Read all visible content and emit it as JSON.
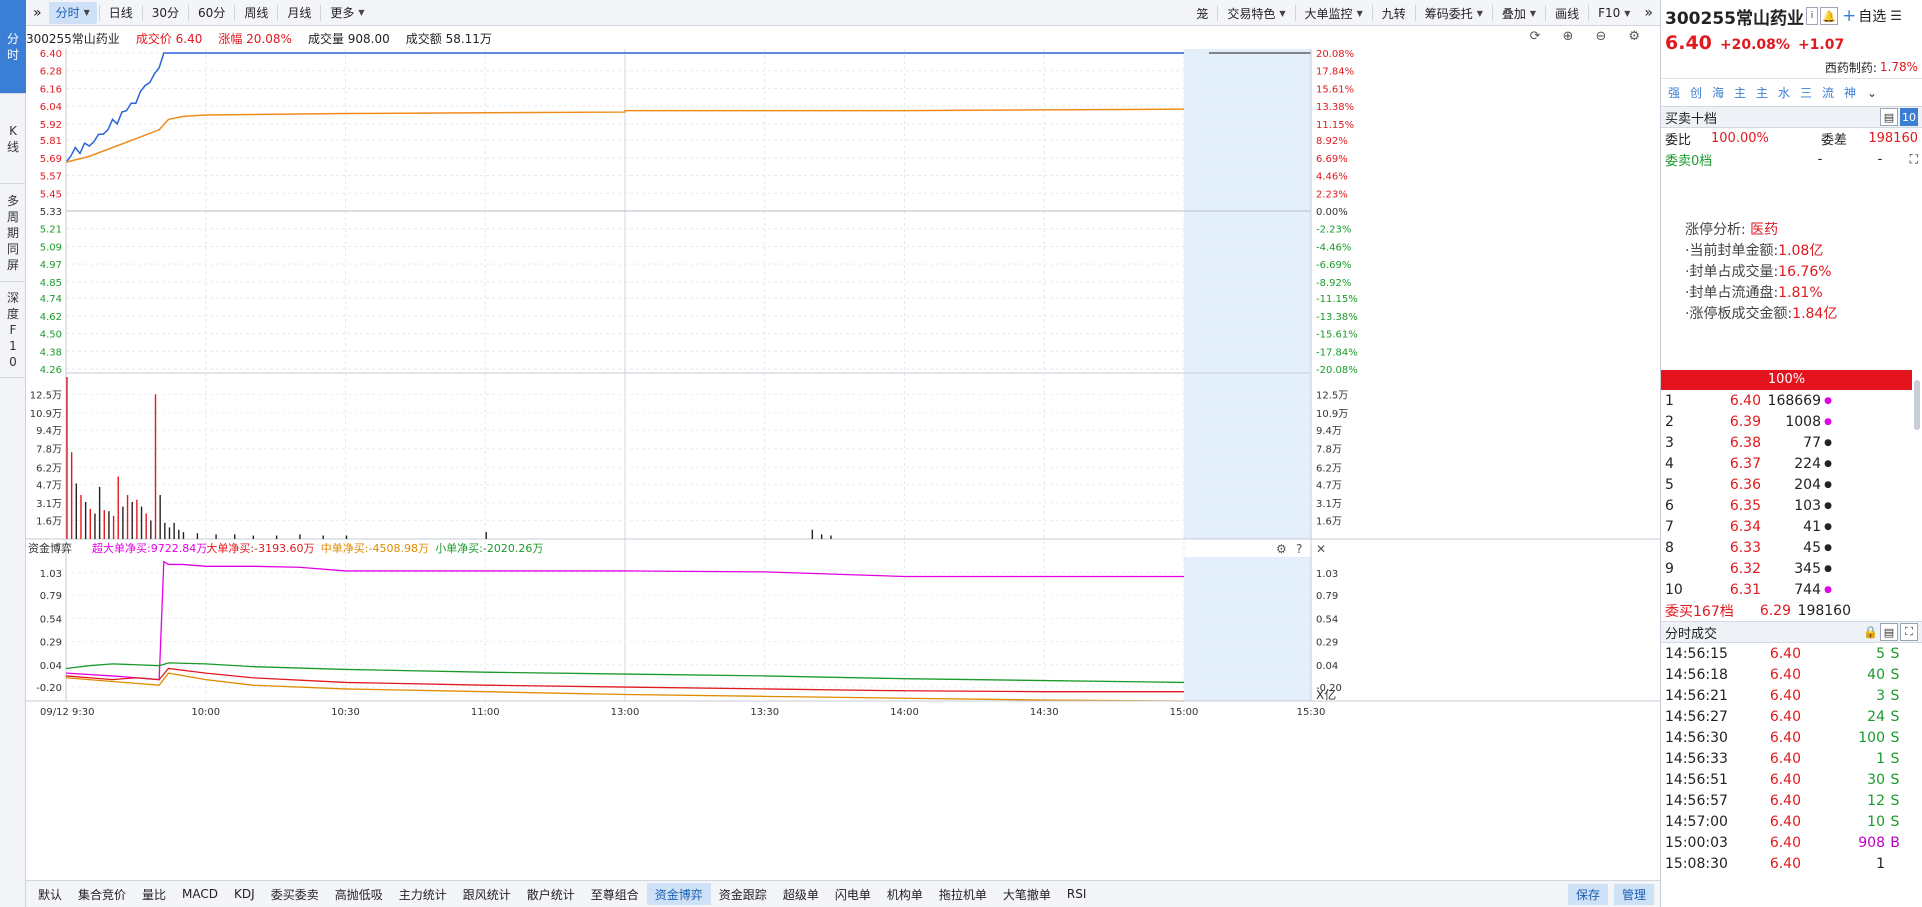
{
  "left_tabs": [
    {
      "label": "分\n时",
      "active": true
    },
    {
      "label": "K\n线",
      "active": false
    },
    {
      "label": "多\n周\n期\n同\n屏",
      "active": false
    },
    {
      "label": "深\n度\nF\n1\n0",
      "active": false
    }
  ],
  "toolbar": {
    "left": [
      {
        "label": "分时",
        "active": true,
        "dropdown": true
      },
      {
        "label": "日线"
      },
      {
        "label": "30分"
      },
      {
        "label": "60分"
      },
      {
        "label": "周线"
      },
      {
        "label": "月线"
      },
      {
        "label": "更多",
        "dropdown": true
      }
    ],
    "right": [
      {
        "label": "笼"
      },
      {
        "label": "交易特色",
        "dropdown": true
      },
      {
        "label": "大单监控",
        "dropdown": true
      },
      {
        "label": "九转"
      },
      {
        "label": "筹码委托",
        "dropdown": true
      },
      {
        "label": "叠加",
        "dropdown": true
      },
      {
        "label": "画线"
      },
      {
        "label": "F10",
        "dropdown": true
      }
    ]
  },
  "infobar": {
    "code_name": "300255常山药业",
    "price_label": "成交价 6.40",
    "change_label": "涨幅 20.08%",
    "volume_label": "成交量 908.00",
    "amount_label": "成交额 58.11万"
  },
  "chart_data": [
    {
      "type": "line",
      "title": "",
      "y_left_ticks": [
        "6.40",
        "6.28",
        "6.16",
        "6.04",
        "5.92",
        "5.81",
        "5.69",
        "5.57",
        "5.45",
        "5.33",
        "5.21",
        "5.09",
        "4.97",
        "4.85",
        "4.74",
        "4.62",
        "4.50",
        "4.38",
        "4.26"
      ],
      "y_right_ticks": [
        "20.08%",
        "17.84%",
        "15.61%",
        "13.38%",
        "11.15%",
        "8.92%",
        "6.69%",
        "4.46%",
        "2.23%",
        "0.00%",
        "-2.23%",
        "-4.46%",
        "-6.69%",
        "-8.92%",
        "-11.15%",
        "-13.38%",
        "-15.61%",
        "-17.84%",
        "-20.08%"
      ],
      "ylim": [
        4.26,
        6.4
      ],
      "prev_close": 5.33,
      "series": [
        {
          "color": "#2b64d8",
          "values_time": [
            "9:30",
            "9:31",
            "9:32",
            "9:33",
            "9:34",
            "9:35",
            "9:36",
            "9:37",
            "9:38",
            "9:39",
            "9:40",
            "9:41",
            "9:42",
            "9:43",
            "9:44",
            "9:45",
            "9:46",
            "9:47",
            "9:48",
            "9:49",
            "9:50",
            "9:51",
            "9:52",
            "15:00"
          ],
          "values": [
            5.66,
            5.7,
            5.76,
            5.72,
            5.79,
            5.77,
            5.8,
            5.85,
            5.85,
            5.88,
            5.95,
            5.92,
            6.0,
            6.01,
            6.06,
            6.06,
            6.14,
            6.18,
            6.2,
            6.26,
            6.3,
            6.4,
            6.4,
            6.4
          ]
        },
        {
          "color": "#f08c1e",
          "values_time": [
            "9:30",
            "9:35",
            "9:40",
            "9:45",
            "9:50",
            "9:52",
            "9:55",
            "10:00",
            "10:30",
            "11:00",
            "11:30",
            "13:00",
            "14:00",
            "15:00"
          ],
          "values": [
            5.66,
            5.7,
            5.76,
            5.82,
            5.88,
            5.95,
            5.97,
            5.98,
            5.99,
            5.995,
            6.0,
            6.01,
            6.01,
            6.02
          ]
        }
      ]
    },
    {
      "type": "bar",
      "title": "",
      "y_ticks": [
        "12.5万",
        "10.9万",
        "9.4万",
        "7.8万",
        "6.2万",
        "4.7万",
        "3.1万",
        "1.6万"
      ],
      "ylim": [
        0,
        140000
      ],
      "bars": [
        {
          "t": 0,
          "v": 140000,
          "c": "r"
        },
        {
          "t": 1,
          "v": 75000,
          "c": "r"
        },
        {
          "t": 2,
          "v": 48000,
          "c": "k"
        },
        {
          "t": 3,
          "v": 38000,
          "c": "r"
        },
        {
          "t": 4,
          "v": 32000,
          "c": "k"
        },
        {
          "t": 5,
          "v": 26000,
          "c": "r"
        },
        {
          "t": 6,
          "v": 22000,
          "c": "k"
        },
        {
          "t": 7,
          "v": 45000,
          "c": "k"
        },
        {
          "t": 8,
          "v": 25000,
          "c": "r"
        },
        {
          "t": 9,
          "v": 24000,
          "c": "k"
        },
        {
          "t": 10,
          "v": 20000,
          "c": "r"
        },
        {
          "t": 11,
          "v": 54000,
          "c": "r"
        },
        {
          "t": 12,
          "v": 28000,
          "c": "k"
        },
        {
          "t": 13,
          "v": 38000,
          "c": "r"
        },
        {
          "t": 14,
          "v": 32000,
          "c": "k"
        },
        {
          "t": 15,
          "v": 34000,
          "c": "r"
        },
        {
          "t": 16,
          "v": 28000,
          "c": "k"
        },
        {
          "t": 17,
          "v": 22000,
          "c": "r"
        },
        {
          "t": 18,
          "v": 16000,
          "c": "k"
        },
        {
          "t": 19,
          "v": 125000,
          "c": "r"
        },
        {
          "t": 20,
          "v": 38000,
          "c": "k"
        },
        {
          "t": 21,
          "v": 14000,
          "c": "k"
        },
        {
          "t": 22,
          "v": 10000,
          "c": "k"
        },
        {
          "t": 23,
          "v": 14000,
          "c": "k"
        },
        {
          "t": 24,
          "v": 8000,
          "c": "k"
        },
        {
          "t": 25,
          "v": 6000,
          "c": "k"
        },
        {
          "t": 28,
          "v": 5000,
          "c": "k"
        },
        {
          "t": 32,
          "v": 4000,
          "c": "k"
        },
        {
          "t": 36,
          "v": 4000,
          "c": "k"
        },
        {
          "t": 40,
          "v": 3000,
          "c": "k"
        },
        {
          "t": 45,
          "v": 3000,
          "c": "k"
        },
        {
          "t": 50,
          "v": 4000,
          "c": "k"
        },
        {
          "t": 55,
          "v": 3000,
          "c": "k"
        },
        {
          "t": 60,
          "v": 3000,
          "c": "k"
        },
        {
          "t": 90,
          "v": 6000,
          "c": "k"
        },
        {
          "t": 160,
          "v": 8000,
          "c": "k"
        },
        {
          "t": 162,
          "v": 4000,
          "c": "k"
        },
        {
          "t": 164,
          "v": 3000,
          "c": "k"
        }
      ]
    },
    {
      "type": "line",
      "title": "资金博弈",
      "legend": [
        {
          "label": "超大单净买:9722.84万",
          "color": "#e400e4"
        },
        {
          "label": "大单净买:-3193.60万",
          "color": "#e1191e"
        },
        {
          "label": "中单净买:-4508.98万",
          "color": "#e08a00"
        },
        {
          "label": "小单净买:-2020.26万",
          "color": "#1a9a2b"
        }
      ],
      "y_ticks": [
        "1.03",
        "0.79",
        "0.54",
        "0.29",
        "0.04",
        "-0.20"
      ],
      "y_unit": "X亿",
      "ylim": [
        -0.35,
        1.2
      ],
      "series": [
        {
          "color": "#e400e4",
          "t": [
            0,
            10,
            20,
            21,
            22,
            25,
            30,
            40,
            50,
            60,
            90,
            120,
            150,
            180,
            210,
            240
          ],
          "v": [
            -0.05,
            -0.08,
            -0.12,
            1.15,
            1.12,
            1.12,
            1.1,
            1.1,
            1.09,
            1.05,
            1.05,
            1.05,
            1.04,
            0.99,
            0.99,
            0.99
          ]
        },
        {
          "color": "#1a9a2b",
          "t": [
            0,
            5,
            10,
            15,
            20,
            22,
            30,
            40,
            60,
            90,
            120,
            150,
            180,
            210,
            240
          ],
          "v": [
            0.0,
            0.03,
            0.05,
            0.04,
            0.03,
            0.06,
            0.05,
            0.02,
            -0.01,
            -0.04,
            -0.06,
            -0.08,
            -0.11,
            -0.13,
            -0.15
          ]
        },
        {
          "color": "#e1191e",
          "t": [
            0,
            5,
            10,
            15,
            20,
            22,
            30,
            40,
            60,
            90,
            120,
            150,
            180,
            210,
            240
          ],
          "v": [
            -0.08,
            -0.1,
            -0.12,
            -0.1,
            -0.12,
            0.0,
            -0.05,
            -0.1,
            -0.15,
            -0.18,
            -0.2,
            -0.22,
            -0.24,
            -0.25,
            -0.25
          ]
        },
        {
          "color": "#e08a00",
          "t": [
            0,
            5,
            10,
            15,
            20,
            22,
            30,
            40,
            60,
            90,
            120,
            150,
            180,
            210,
            240
          ],
          "v": [
            -0.1,
            -0.12,
            -0.14,
            -0.16,
            -0.18,
            -0.05,
            -0.12,
            -0.18,
            -0.22,
            -0.25,
            -0.28,
            -0.3,
            -0.32,
            -0.34,
            -0.35
          ]
        }
      ]
    }
  ],
  "x_axis": {
    "date": "09/12 9:30",
    "ticks": [
      "10:00",
      "10:30",
      "11:00",
      "13:00",
      "13:30",
      "14:00",
      "14:30",
      "15:00",
      "15:30"
    ]
  },
  "bottom_tabs": [
    {
      "label": "默认"
    },
    {
      "label": "集合竞价"
    },
    {
      "label": "量比"
    },
    {
      "label": "MACD"
    },
    {
      "label": "KDJ"
    },
    {
      "label": "委买委卖"
    },
    {
      "label": "高抛低吸"
    },
    {
      "label": "主力统计"
    },
    {
      "label": "跟风统计"
    },
    {
      "label": "散户统计"
    },
    {
      "label": "至尊组合"
    },
    {
      "label": "资金博弈",
      "active": true
    },
    {
      "label": "资金跟踪"
    },
    {
      "label": "超级单"
    },
    {
      "label": "闪电单"
    },
    {
      "label": "机构单"
    },
    {
      "label": "拖拉机单"
    },
    {
      "label": "大笔撤单"
    },
    {
      "label": "RSI"
    }
  ],
  "bottom_buttons": {
    "save": "保存",
    "manage": "管理"
  },
  "right_panel": {
    "title": "300255常山药业",
    "watch_btn": "自选",
    "price": "6.40",
    "change_pct": "+20.08%",
    "change_amt": "+1.07",
    "sector": "西药制药:",
    "sector_pct": "1.78%",
    "quick_buttons": [
      "强",
      "创",
      "海",
      "主",
      "主",
      "水",
      "三",
      "流",
      "神"
    ],
    "orderbook_title": "买卖十档",
    "orderbook_toggle": "10",
    "weibi_label": "委比",
    "weibi_value": "100.00%",
    "weicha_label": "委差",
    "weicha_value": "198160",
    "weimai0_label": "委卖0档",
    "weimai0_a": "-",
    "weimai0_b": "-",
    "limit_analysis": {
      "label": "涨停分析:",
      "value": "医药",
      "rows": [
        {
          "label": "·当前封单金额:",
          "value": "1.08亿"
        },
        {
          "label": "·封单占成交量:",
          "value": "16.76%"
        },
        {
          "label": "·封单占流通盘:",
          "value": "1.81%"
        },
        {
          "label": "·涨停板成交金额:",
          "value": "1.84亿"
        }
      ]
    },
    "bar_pct": "100%",
    "bids": [
      {
        "lvl": "1",
        "px": "6.40",
        "vol": "168669",
        "dot": "#e400e4"
      },
      {
        "lvl": "2",
        "px": "6.39",
        "vol": "1008",
        "dot": "#e400e4"
      },
      {
        "lvl": "3",
        "px": "6.38",
        "vol": "77",
        "dot": "#222"
      },
      {
        "lvl": "4",
        "px": "6.37",
        "vol": "224",
        "dot": "#222"
      },
      {
        "lvl": "5",
        "px": "6.36",
        "vol": "204",
        "dot": "#222"
      },
      {
        "lvl": "6",
        "px": "6.35",
        "vol": "103",
        "dot": "#222"
      },
      {
        "lvl": "7",
        "px": "6.34",
        "vol": "41",
        "dot": "#222"
      },
      {
        "lvl": "8",
        "px": "6.33",
        "vol": "45",
        "dot": "#222"
      },
      {
        "lvl": "9",
        "px": "6.32",
        "vol": "345",
        "dot": "#222"
      },
      {
        "lvl": "10",
        "px": "6.31",
        "vol": "744",
        "dot": "#e400e4"
      }
    ],
    "weimai_total_label": "委买167档",
    "weimai_total_px": "6.29",
    "weimai_total_vol": "198160",
    "trades_title": "分时成交",
    "trades": [
      {
        "t": "14:56:15",
        "p": "6.40",
        "v": "5",
        "d": "S",
        "c": "#1a9a2b"
      },
      {
        "t": "14:56:18",
        "p": "6.40",
        "v": "40",
        "d": "S",
        "c": "#1a9a2b"
      },
      {
        "t": "14:56:21",
        "p": "6.40",
        "v": "3",
        "d": "S",
        "c": "#1a9a2b"
      },
      {
        "t": "14:56:27",
        "p": "6.40",
        "v": "24",
        "d": "S",
        "c": "#1a9a2b"
      },
      {
        "t": "14:56:30",
        "p": "6.40",
        "v": "100",
        "d": "S",
        "c": "#1a9a2b"
      },
      {
        "t": "14:56:33",
        "p": "6.40",
        "v": "1",
        "d": "S",
        "c": "#1a9a2b"
      },
      {
        "t": "14:56:51",
        "p": "6.40",
        "v": "30",
        "d": "S",
        "c": "#1a9a2b"
      },
      {
        "t": "14:56:57",
        "p": "6.40",
        "v": "12",
        "d": "S",
        "c": "#1a9a2b"
      },
      {
        "t": "14:57:00",
        "p": "6.40",
        "v": "10",
        "d": "S",
        "c": "#1a9a2b"
      },
      {
        "t": "15:00:03",
        "p": "6.40",
        "v": "908",
        "d": "B",
        "c": "#c000c0"
      },
      {
        "t": "15:08:30",
        "p": "6.40",
        "v": "1",
        "d": "",
        "c": "#222"
      }
    ]
  }
}
